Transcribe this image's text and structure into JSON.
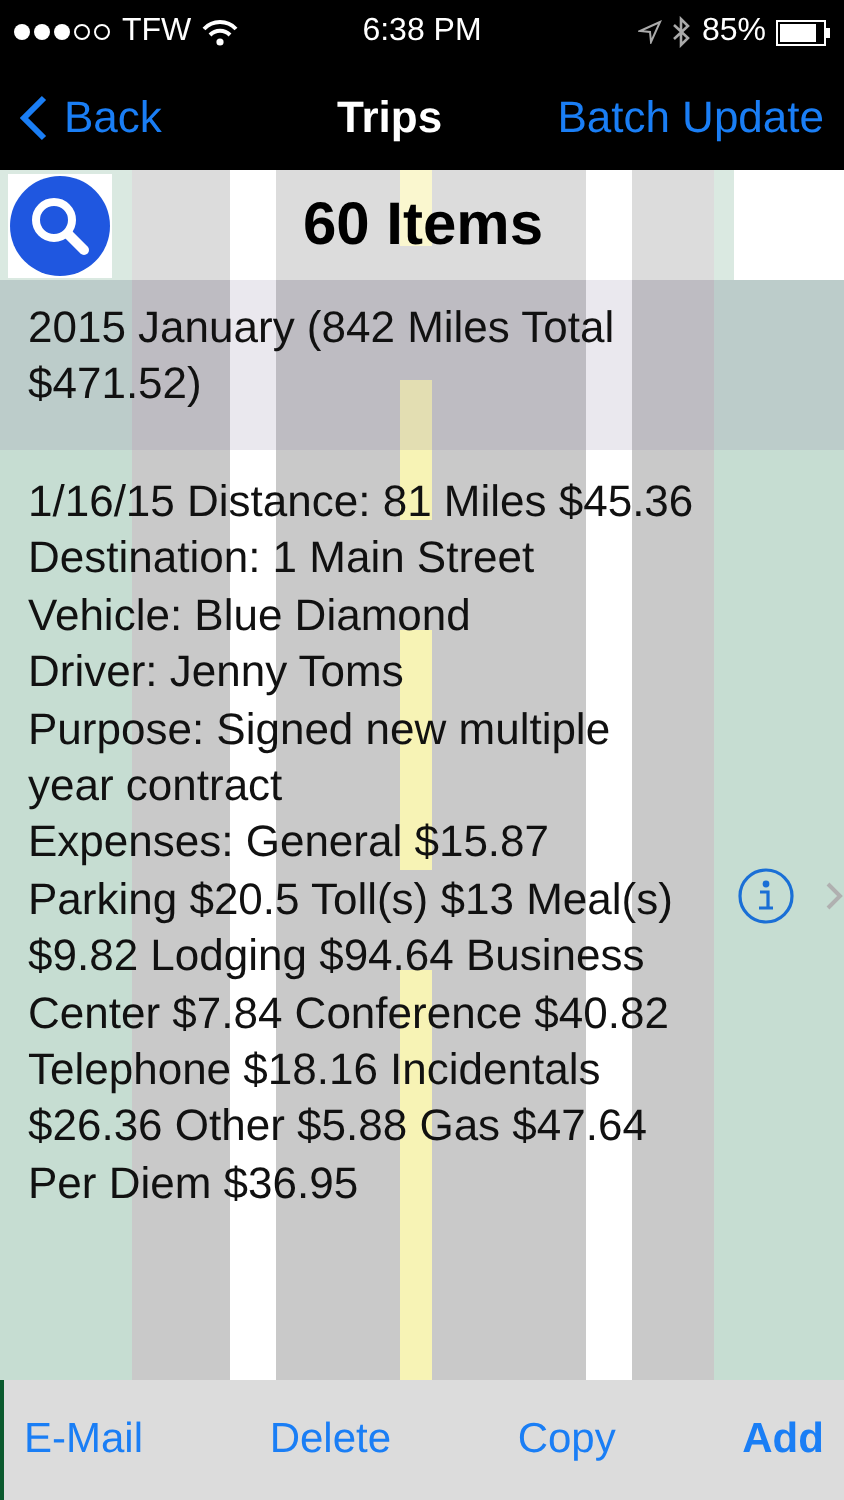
{
  "status_bar": {
    "carrier": "TFW",
    "time": "6:38 PM",
    "battery": "85%"
  },
  "nav": {
    "back": "Back",
    "title": "Trips",
    "action": "Batch Update"
  },
  "header": {
    "count": "60 Items"
  },
  "sections": [
    {
      "title": "2015 January (842 Miles Total $471.52)",
      "rows": [
        {
          "lines": [
            "1/16/15 Distance: 81 Miles $45.36",
            "Destination: 1 Main Street",
            "Vehicle: Blue Diamond",
            "Driver: Jenny Toms",
            "Purpose: Signed new multiple year contract",
            "Expenses: General $15.87 Parking $20.5 Toll(s) $13 Meal(s) $9.82 Lodging $94.64 Business Center $7.84 Conference $40.82 Telephone $18.16 Incidentals $26.36 Other $5.88 Gas $47.64 Per Diem $36.95"
          ]
        }
      ]
    }
  ],
  "toolbar": [
    {
      "label": "E-Mail",
      "kind": "plain"
    },
    {
      "label": "Delete",
      "kind": "plain"
    },
    {
      "label": "Copy",
      "kind": "plain"
    },
    {
      "label": "Add",
      "kind": "bold"
    }
  ]
}
